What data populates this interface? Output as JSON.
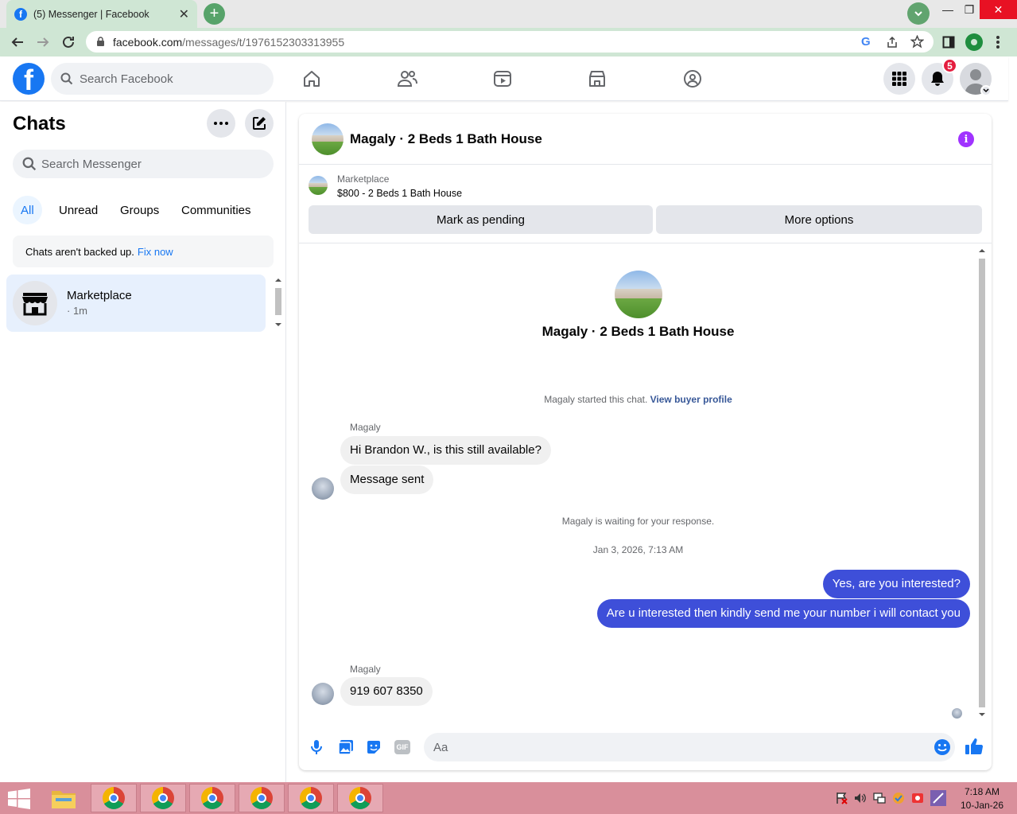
{
  "browser": {
    "tab_title": "(5) Messenger | Facebook",
    "url_domain": "facebook.com",
    "url_path": "/messages/t/1976152303313955"
  },
  "fb_header": {
    "search_placeholder": "Search Facebook",
    "notification_count": "5"
  },
  "sidebar": {
    "title": "Chats",
    "search_placeholder": "Search Messenger",
    "filters": [
      "All",
      "Unread",
      "Groups",
      "Communities"
    ],
    "backup_text": "Chats aren't backed up.",
    "backup_link": "Fix now",
    "chats": [
      {
        "name": "Marketplace",
        "time": "· 1m"
      }
    ]
  },
  "chat": {
    "header_name": "Magaly · 2 Beds 1 Bath House",
    "marketplace_label": "Marketplace",
    "listing": "$800 - 2 Beds 1 Bath House",
    "mark_pending_label": "Mark as pending",
    "more_options_label": "More options",
    "intro_name": "Magaly · 2 Beds 1 Bath House",
    "started_text": "Magaly started this chat.",
    "buyer_profile_link": "View buyer profile",
    "sender_1": "Magaly",
    "msg_1": "Hi Brandon W., is this still available?",
    "msg_2": "Message sent",
    "waiting_text": "Magaly is waiting for your response.",
    "timestamp": "Jan 3, 2026, 7:13 AM",
    "out_1": "Yes, are you interested?",
    "out_2": "Are u interested then kindly send me your number i will contact you",
    "sender_2": "Magaly",
    "msg_3": "919 607 8350",
    "composer_placeholder": "Aa"
  },
  "taskbar": {
    "time": "7:18 AM",
    "date": "10-Jan-26"
  },
  "colors": {
    "brand": "#1877f2",
    "outgoing_bubble": "#3e4fd9",
    "info_icon": "#a033ff",
    "badge": "#e41e3f"
  }
}
